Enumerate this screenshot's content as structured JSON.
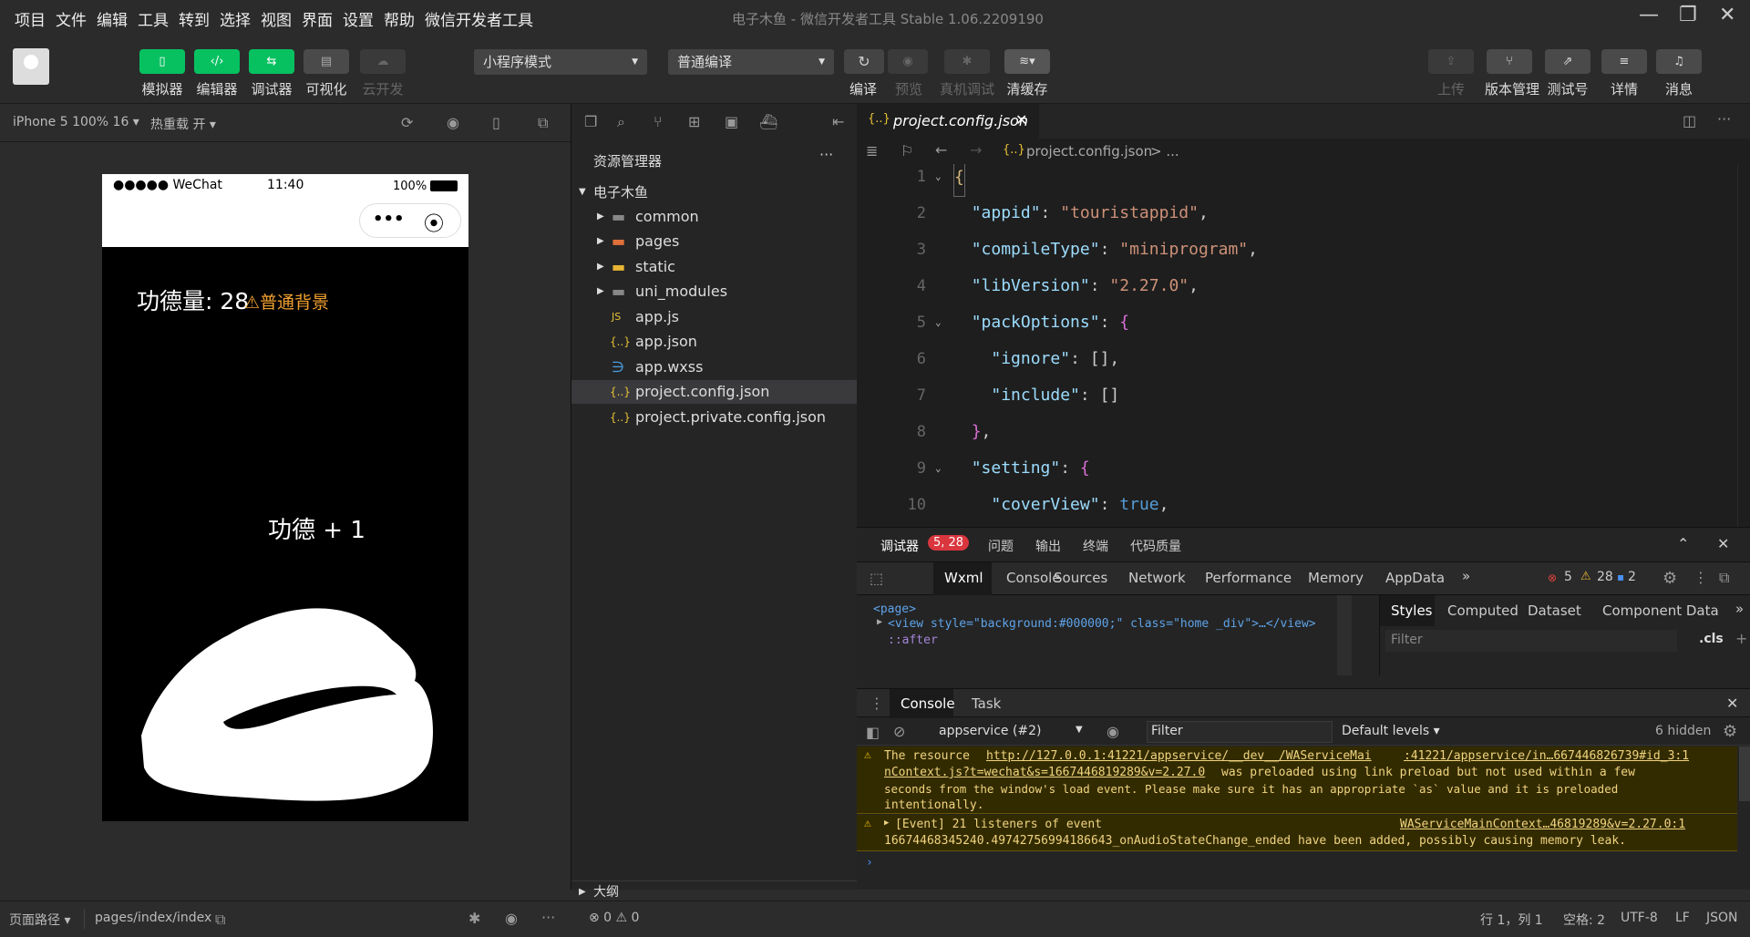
{
  "window": {
    "title": "电子木鱼 - 微信开发者工具 Stable 1.06.2209190"
  },
  "menu": [
    "项目",
    "文件",
    "编辑",
    "工具",
    "转到",
    "选择",
    "视图",
    "界面",
    "设置",
    "帮助",
    "微信开发者工具"
  ],
  "toolbar": {
    "simulator": "模拟器",
    "editor": "编辑器",
    "debugger": "调试器",
    "visual": "可视化",
    "cloud": "云开发",
    "mode": "小程序模式",
    "compile_mode": "普通编译",
    "compile": "编译",
    "preview": "预览",
    "real_debug": "真机调试",
    "clear_cache": "清缓存",
    "upload": "上传",
    "version": "版本管理",
    "test": "测试号",
    "details": "详情",
    "messages": "消息"
  },
  "simulator": {
    "device": "iPhone 5 100% 16 ▾",
    "hot_reload": "热重载 开 ▾",
    "carrier": "●●●●● WeChat",
    "time": "11:40",
    "battery": "100%",
    "merit": "功德量: 28",
    "bg_label": "⚠普通背景",
    "plus": "功德 + 1"
  },
  "explorer": {
    "title": "资源管理器",
    "project": "电子木鱼",
    "items": [
      {
        "name": "common",
        "type": "folder"
      },
      {
        "name": "pages",
        "type": "folder"
      },
      {
        "name": "static",
        "type": "folder"
      },
      {
        "name": "uni_modules",
        "type": "folder"
      },
      {
        "name": "app.js",
        "type": "js"
      },
      {
        "name": "app.json",
        "type": "json"
      },
      {
        "name": "app.wxss",
        "type": "css"
      },
      {
        "name": "project.config.json",
        "type": "json"
      },
      {
        "name": "project.private.config.json",
        "type": "json"
      }
    ],
    "outline": "大纲"
  },
  "editor": {
    "tab": "project.config.json",
    "breadcrumb": "project.config.json",
    "breadcrumb_more": "> ...",
    "lines": [
      {
        "n": "1",
        "t": "{"
      },
      {
        "n": "2",
        "t": "  \"appid\": \"touristappid\","
      },
      {
        "n": "3",
        "t": "  \"compileType\": \"miniprogram\","
      },
      {
        "n": "4",
        "t": "  \"libVersion\": \"2.27.0\","
      },
      {
        "n": "5",
        "t": "  \"packOptions\": {"
      },
      {
        "n": "6",
        "t": "    \"ignore\": [],"
      },
      {
        "n": "7",
        "t": "    \"include\": []"
      },
      {
        "n": "8",
        "t": "  },"
      },
      {
        "n": "9",
        "t": "  \"setting\": {"
      },
      {
        "n": "10",
        "t": "    \"coverView\": true,"
      }
    ]
  },
  "devtools": {
    "top_tabs": [
      "调试器",
      "问题",
      "输出",
      "终端",
      "代码质量"
    ],
    "badge": "5, 28",
    "panels": [
      "Wxml",
      "Console",
      "Sources",
      "Network",
      "Performance",
      "Memory",
      "AppData"
    ],
    "errors": "5",
    "warnings": "28",
    "infos": "2",
    "style_tabs": [
      "Styles",
      "Computed",
      "Dataset",
      "Component Data"
    ],
    "filter": "Filter",
    "cls": ".cls",
    "wxml": [
      "<page>",
      "<view style=\"background:#000000;\" class=\"home _div\">…</view>",
      "::after"
    ],
    "console_tabs": [
      "Console",
      "Task"
    ],
    "context": "appservice (#2)",
    "levels": "Default levels ▾",
    "hidden": "6 hidden",
    "msg1_a": "The resource ",
    "msg1_link": "http://127.0.0.1:41221/appservice/__dev__/WAServiceMai",
    "msg1_src": ":41221/appservice/in…667446826739#id_3:1",
    "msg1_b": "nContext.js?t=wechat&s=1667446819289&v=2.27.0",
    "msg1_c": " was preloaded using link preload but not used within a few",
    "msg1_d": "seconds from the window's load event. Please make sure it has an appropriate `as` value and it is preloaded",
    "msg1_e": "intentionally.",
    "msg2_a": "[Event] 21 listeners of event",
    "msg2_src": "WAServiceMainContext…46819289&v=2.27.0:1",
    "msg2_b": "16674468345240.49742756994186643_onAudioStateChange_ended have been added, possibly causing memory leak."
  },
  "statusbar": {
    "page_path": "页面路径 ▾",
    "path": "pages/index/index",
    "errors": "⊗ 0 ⚠ 0",
    "pos": "行 1，列 1",
    "spaces": "空格: 2",
    "encoding": "UTF-8",
    "eol": "LF",
    "lang": "JSON"
  }
}
